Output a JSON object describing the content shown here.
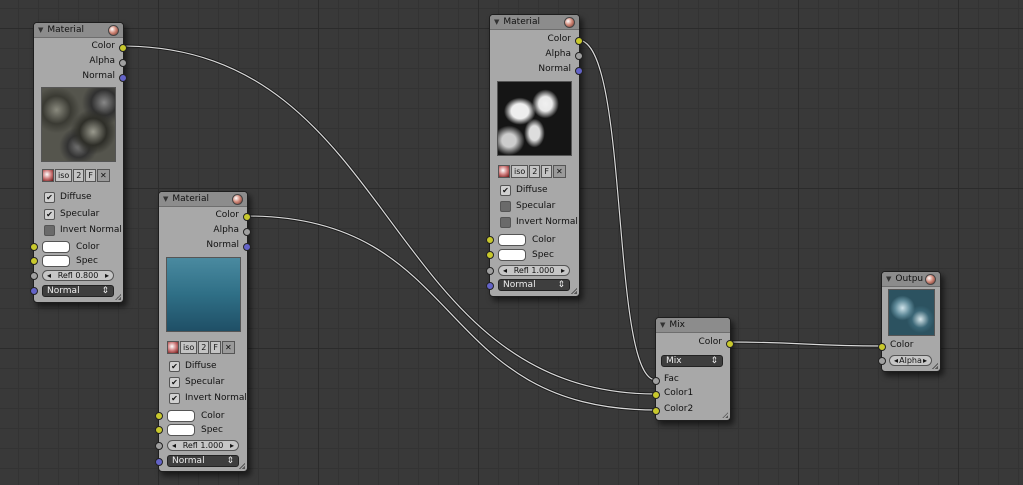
{
  "nodes": {
    "material1": {
      "title": "Material",
      "outputs": [
        "Color",
        "Alpha",
        "Normal"
      ],
      "texture": {
        "iso": "iso",
        "num": "2",
        "flag": "F"
      },
      "checks": [
        {
          "label": "Diffuse",
          "checked": true
        },
        {
          "label": "Specular",
          "checked": true
        },
        {
          "label": "Invert Normal",
          "checked": false
        }
      ],
      "inputs": {
        "color": "Color",
        "spec": "Spec",
        "refl": "Refl 0.800",
        "normal": "Normal"
      }
    },
    "material2": {
      "title": "Material",
      "outputs": [
        "Color",
        "Alpha",
        "Normal"
      ],
      "texture": {
        "iso": "iso",
        "num": "2",
        "flag": "F"
      },
      "checks": [
        {
          "label": "Diffuse",
          "checked": true
        },
        {
          "label": "Specular",
          "checked": true
        },
        {
          "label": "Invert Normal",
          "checked": true
        }
      ],
      "inputs": {
        "color": "Color",
        "spec": "Spec",
        "refl": "Refl 1.000",
        "normal": "Normal"
      }
    },
    "material3": {
      "title": "Material",
      "outputs": [
        "Color",
        "Alpha",
        "Normal"
      ],
      "texture": {
        "iso": "iso",
        "num": "2",
        "flag": "F"
      },
      "checks": [
        {
          "label": "Diffuse",
          "checked": true
        },
        {
          "label": "Specular",
          "checked": false
        },
        {
          "label": "Invert Normal",
          "checked": false
        }
      ],
      "inputs": {
        "color": "Color",
        "spec": "Spec",
        "refl": "Refl 1.000",
        "normal": "Normal"
      }
    },
    "mix": {
      "title": "Mix",
      "output": "Color",
      "mode": "Mix",
      "inputs": [
        "Fac",
        "Color1",
        "Color2"
      ]
    },
    "output": {
      "title": "Outpu",
      "inputs": {
        "color": "Color",
        "alpha": "Alpha"
      }
    }
  },
  "colors": {
    "wire": "#d8d8d8",
    "socket_color": "#c8c82c",
    "socket_value": "#a0a0a0",
    "socket_vector": "#6363c7"
  },
  "icons": [
    "collapse-arrow-icon",
    "material-sphere-icon",
    "close-icon",
    "resize-handle-icon"
  ]
}
